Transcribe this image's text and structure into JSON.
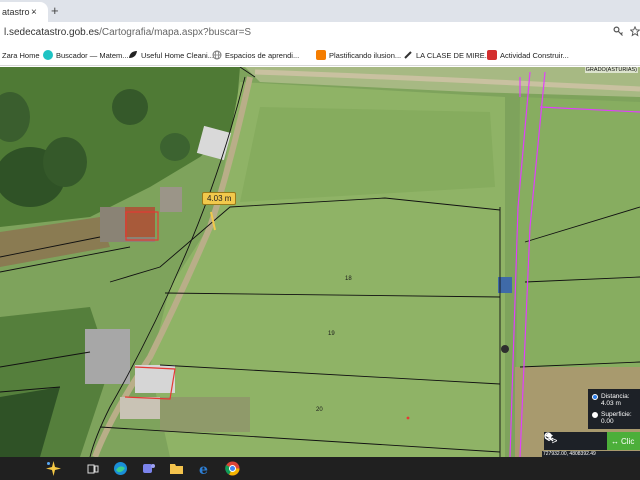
{
  "browser": {
    "tab_title": "atastro ·",
    "tab_close": "×",
    "new_tab": "+",
    "url_domain": "l.sedecatastro.gob.es",
    "url_path": "/Cartografia/mapa.aspx?buscar=S",
    "address_icons": [
      "key-icon",
      "star-icon"
    ]
  },
  "bookmarks": [
    {
      "label": "Zara Home",
      "icon": "zara-icon",
      "color": "#444444"
    },
    {
      "label": "Buscador — Matem...",
      "icon": "circle-icon",
      "color": "#1ec3c3"
    },
    {
      "label": "Useful Home Cleani...",
      "icon": "leaf-icon",
      "color": "#222222"
    },
    {
      "label": "Espacios de aprendi...",
      "icon": "globe-icon",
      "color": "#777777"
    },
    {
      "label": "Plastificando ilusion...",
      "icon": "blogger-icon",
      "color": "#f57d00"
    },
    {
      "label": "LA CLASE DE MIRE...",
      "icon": "pencil-icon",
      "color": "#333333"
    },
    {
      "label": "Actividad Construir...",
      "icon": "gift-icon",
      "color": "#d32f2f"
    }
  ],
  "map": {
    "region_label": "GRADO(ASTURIAS)",
    "measure_label": "4.03 m",
    "parcel_labels": [
      "18",
      "19",
      "20"
    ],
    "info": {
      "distance_label": "Distancia:",
      "distance_value": "4.03 m",
      "area_label": "Superficie:",
      "area_value": "0.00"
    },
    "toolbar": {
      "next_icon": ">",
      "green_label": "Clic"
    },
    "coords_text": "727932.00, 4808392.49",
    "colors": {
      "parcel_line": "#111111",
      "boundary_magenta": "#e040fb",
      "selected_red": "#e53935",
      "measure_line": "#f2c94c"
    }
  },
  "taskbar": {
    "icons": [
      "copilot-icon",
      "taskview-icon",
      "edge-icon",
      "teams-icon",
      "explorer-icon",
      "ie-icon",
      "chrome-icon"
    ]
  }
}
